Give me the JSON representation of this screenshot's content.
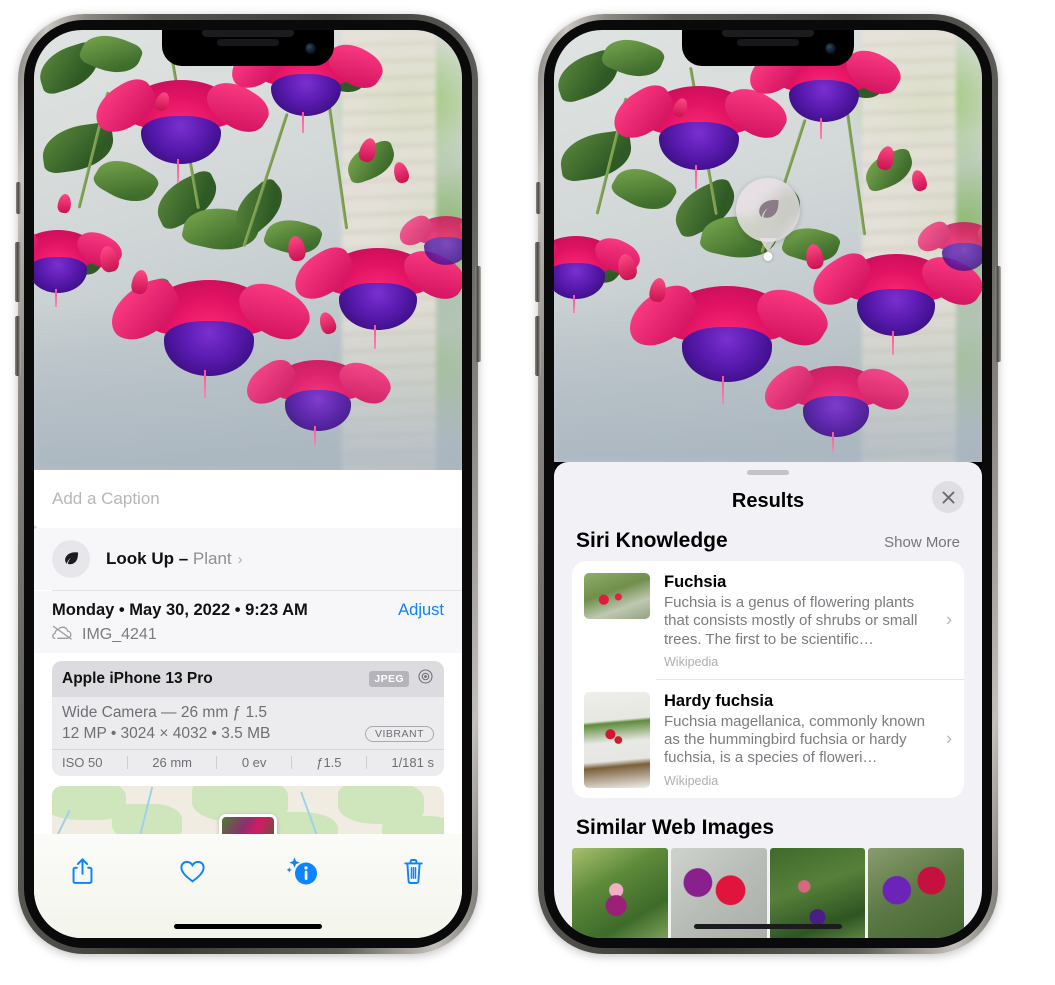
{
  "left_phone": {
    "caption": {
      "placeholder": "Add a Caption"
    },
    "lookup": {
      "label": "Look Up – ",
      "subject": "Plant",
      "chevron": "›",
      "icon": "leaf-icon"
    },
    "meta": {
      "date": "Monday • May 30, 2022 • 9:23 AM",
      "adjust_label": "Adjust",
      "filename": "IMG_4241",
      "cloud_icon": "icloud-slash-icon"
    },
    "camera_card": {
      "device": "Apple iPhone 13 Pro",
      "format_badge": "JPEG",
      "raw_icon": "aperture-icon",
      "lens_line": "Wide Camera — 26 mm ƒ 1.5",
      "specs_line": "12 MP • 3024 × 4032 • 3.5 MB",
      "style_badge": "VIBRANT",
      "exif": [
        "ISO 50",
        "26 mm",
        "0 ev",
        "ƒ1.5",
        "1/181 s"
      ]
    },
    "toolbar": {
      "share_label": "share-icon",
      "favorite_label": "heart-icon",
      "info_label": "info-sparkle-icon",
      "delete_label": "trash-icon"
    }
  },
  "right_phone": {
    "badge": {
      "icon": "leaf-icon"
    },
    "sheet": {
      "title": "Results",
      "close_label": "✕"
    },
    "siri_knowledge": {
      "title": "Siri Knowledge",
      "show_more": "Show More",
      "items": [
        {
          "title": "Fuchsia",
          "description": "Fuchsia is a genus of flowering plants that consists mostly of shrubs or small trees. The first to be scientific…",
          "source": "Wikipedia",
          "chevron": "›"
        },
        {
          "title": "Hardy fuchsia",
          "description": "Fuchsia magellanica, commonly known as the hummingbird fuchsia or hardy fuchsia, is a species of floweri…",
          "source": "Wikipedia",
          "chevron": "›"
        }
      ]
    },
    "similar_web_images": {
      "title": "Similar Web Images",
      "count": 4
    }
  },
  "colors": {
    "accent_blue": "#0a84ff",
    "sheet_bg": "#f2f1f6",
    "card_bg": "#ffffff",
    "secondary_text": "#7b7b81"
  }
}
